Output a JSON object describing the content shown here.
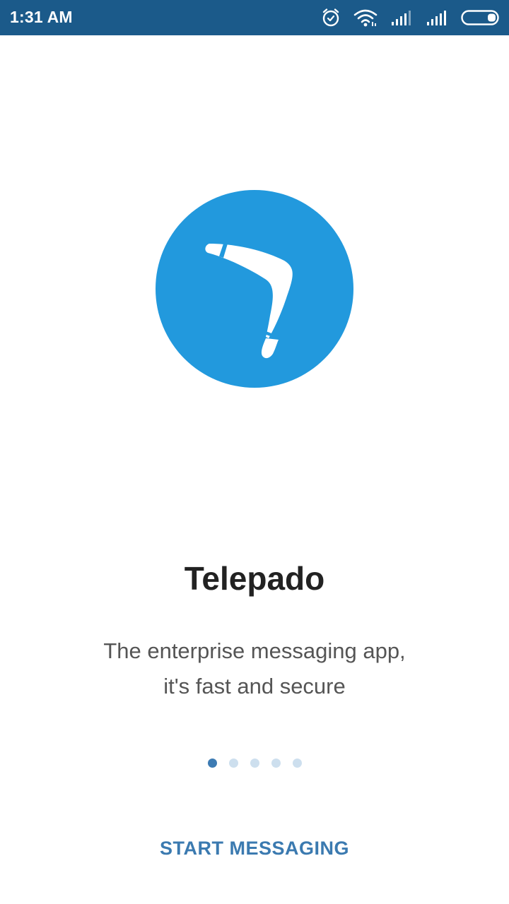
{
  "status_bar": {
    "time": "1:31 AM",
    "icons": [
      "alarm-icon",
      "wifi-icon",
      "signal-icon",
      "signal-icon",
      "battery-icon"
    ],
    "background_color": "#1b5a8a"
  },
  "onboarding": {
    "logo_icon": "boomerang-icon",
    "logo_color": "#2299dd",
    "title": "Telepado",
    "description_lines": [
      "The enterprise messaging app,",
      "it's fast and secure"
    ],
    "pager": {
      "total_pages": 5,
      "current_page": 1,
      "active_color": "#3d7bb3",
      "inactive_color": "#cddfee"
    },
    "start_button_label": "START MESSAGING",
    "accent_color": "#3b7ab0"
  }
}
